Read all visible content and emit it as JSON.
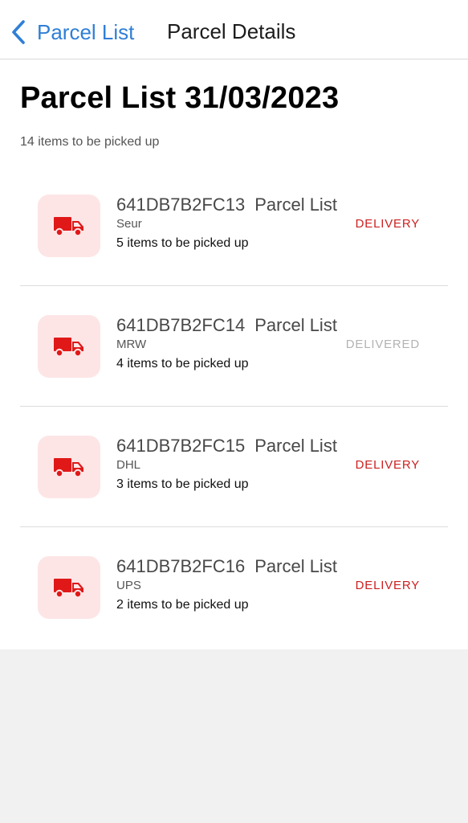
{
  "nav": {
    "back_label": "Parcel List",
    "title": "Parcel Details"
  },
  "page": {
    "title": "Parcel List 31/03/2023",
    "subtitle": "14 items to be picked up"
  },
  "colors": {
    "accent": "#2f7fd6",
    "delivery": "#cc1f1f",
    "delivered": "#b3b3b3",
    "icon_tile": "#fde5e6",
    "truck": "#e01818"
  },
  "parcels": [
    {
      "icon": "truck-icon",
      "code": "641DB7B2FC13",
      "list_label": "Parcel List",
      "carrier": "Seur",
      "items": "5 items to be picked up",
      "status": "DELIVERY",
      "status_color": "#cc1f1f"
    },
    {
      "icon": "truck-icon",
      "code": "641DB7B2FC14",
      "list_label": "Parcel List",
      "carrier": "MRW",
      "items": "4 items to be picked up",
      "status": "DELIVERED",
      "status_color": "#b3b3b3"
    },
    {
      "icon": "truck-icon",
      "code": "641DB7B2FC15",
      "list_label": "Parcel List",
      "carrier": "DHL",
      "items": "3 items to be picked up",
      "status": "DELIVERY",
      "status_color": "#cc1f1f"
    },
    {
      "icon": "truck-icon",
      "code": "641DB7B2FC16",
      "list_label": "Parcel List",
      "carrier": "UPS",
      "items": "2 items to be picked up",
      "status": "DELIVERY",
      "status_color": "#cc1f1f"
    }
  ]
}
